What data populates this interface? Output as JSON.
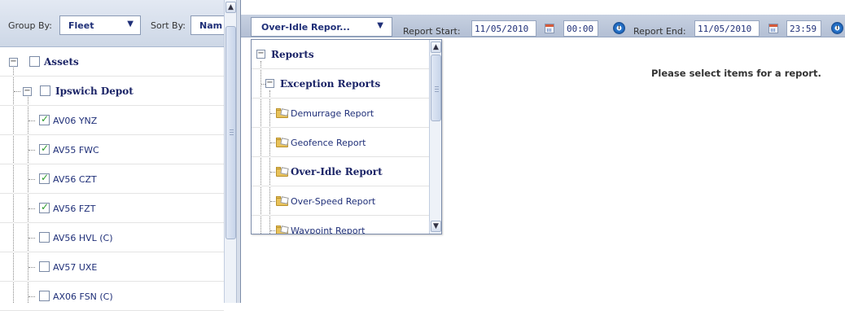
{
  "toolbar": {
    "group_by_label": "Group By:",
    "group_by_value": "Fleet",
    "sort_by_label": "Sort By:",
    "sort_by_value": "Nam"
  },
  "report_bar": {
    "report_type_value": "Over-Idle Repor...",
    "start_label": "Report Start:",
    "start_date": "11/05/2010",
    "start_time": "00:00",
    "end_label": "Report End:",
    "end_date": "11/05/2010",
    "end_time": "23:59"
  },
  "message": "Please select items for a report.",
  "tree": {
    "root_label": "Assets",
    "depot_label": "Ipswich Depot",
    "assets": [
      {
        "label": "AV06 YNZ",
        "checked": true
      },
      {
        "label": "AV55 FWC",
        "checked": true
      },
      {
        "label": "AV56 CZT",
        "checked": true
      },
      {
        "label": "AV56 FZT",
        "checked": true
      },
      {
        "label": "AV56 HVL (C)",
        "checked": false
      },
      {
        "label": "AV57 UXE",
        "checked": false
      },
      {
        "label": "AX06 FSN (C)",
        "checked": false
      }
    ]
  },
  "popup": {
    "root_label": "Reports",
    "group_label": "Exception Reports",
    "items": [
      {
        "label": "Demurrage Report",
        "selected": false
      },
      {
        "label": "Geofence Report",
        "selected": false
      },
      {
        "label": "Over-Idle Report",
        "selected": true
      },
      {
        "label": "Over-Speed Report",
        "selected": false
      },
      {
        "label": "Waypoint Report",
        "selected": false
      }
    ]
  },
  "icons": {
    "expand": "minus-box-icon",
    "calendar": "calendar-icon",
    "clock": "clock-icon",
    "folder": "report-folder-icon",
    "scroll_up": "▲",
    "scroll_down": "▼",
    "dropdown": "▼",
    "collapse_glyph": "−"
  },
  "colors": {
    "accent_text": "#1f2f78",
    "checkmark": "#2a9b2a",
    "toolbar_bg": "#c7d1e1"
  }
}
